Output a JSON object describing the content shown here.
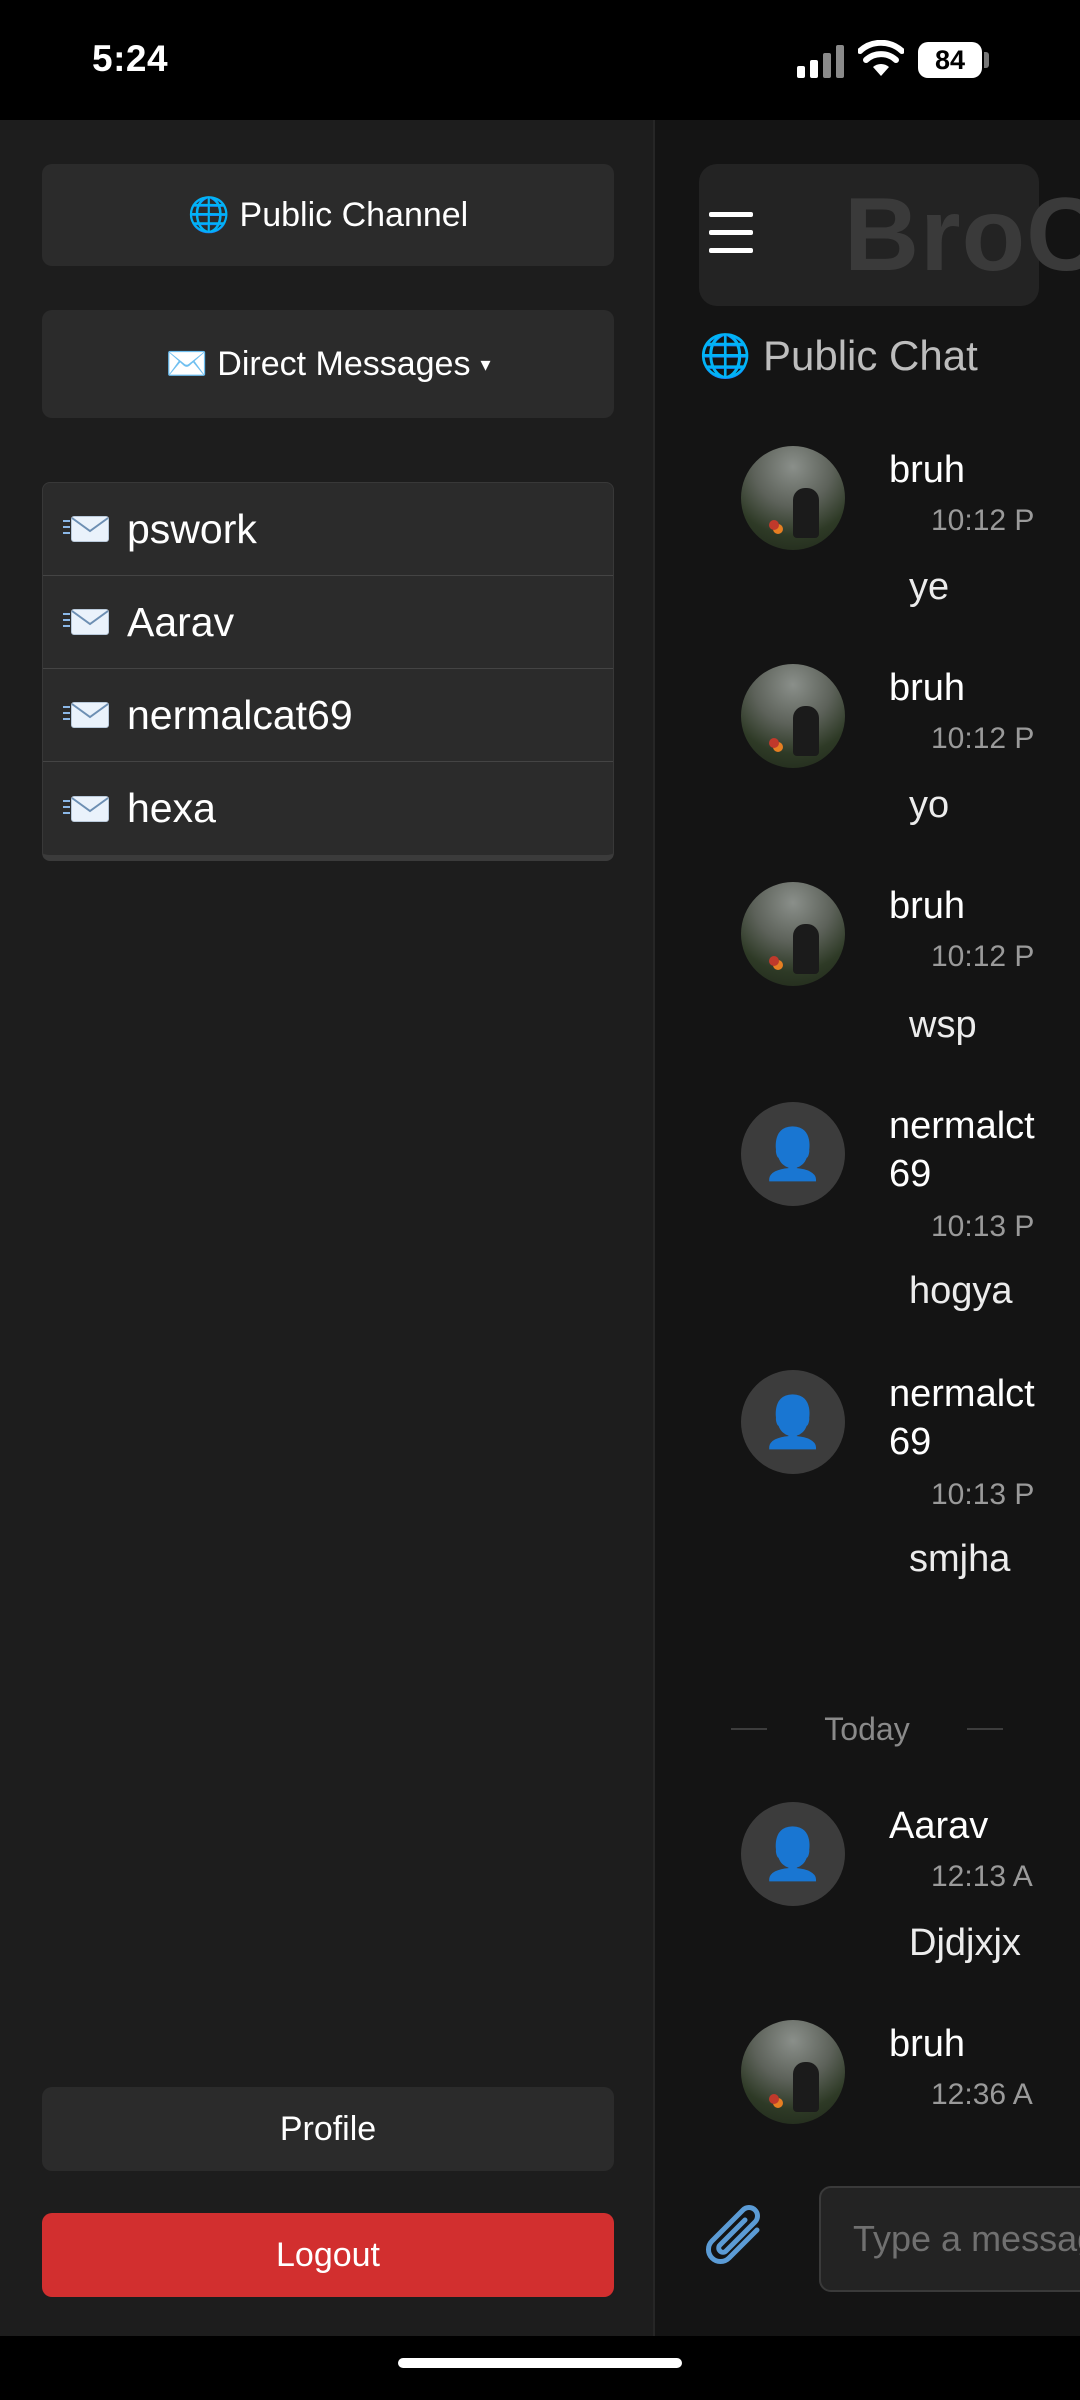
{
  "status_bar": {
    "time": "5:24",
    "battery": "84"
  },
  "sidebar": {
    "public_channel": {
      "icon": "globe-icon",
      "label": "🌐 Public Channel"
    },
    "direct_messages": {
      "icon": "envelope-icon",
      "label": "✉️ Direct Messages",
      "caret": "▾"
    },
    "dm_items": [
      {
        "icon": "incoming-envelope-icon",
        "label": "pswork"
      },
      {
        "icon": "incoming-envelope-icon",
        "label": "Aarav"
      },
      {
        "icon": "incoming-envelope-icon",
        "label": "nermalcat69"
      },
      {
        "icon": "incoming-envelope-icon",
        "label": "hexa"
      }
    ],
    "profile_label": "Profile",
    "logout_label": "Logout",
    "logout_color": "#d22f2f"
  },
  "chat": {
    "menu_icon": "☰",
    "brand": "BroC",
    "channel_title": "🌐 Public Chat",
    "messages": [
      {
        "user": "bruh",
        "time": "10:12 P",
        "text": "ye",
        "avatar": "photo"
      },
      {
        "user": "bruh",
        "time": "10:12 P",
        "text": "yo",
        "avatar": "photo"
      },
      {
        "user": "bruh",
        "time": "10:12 P",
        "text": "wsp",
        "avatar": "photo"
      },
      {
        "user": "nermalct69",
        "time": "10:13 P",
        "text": "hogya",
        "avatar": "default"
      },
      {
        "user": "nermalct69",
        "time": "10:13 P",
        "text": "smjha",
        "avatar": "default"
      },
      {
        "user": "Aarav",
        "time": "12:13 A",
        "text": "Djdjxjx",
        "avatar": "default"
      },
      {
        "user": "bruh",
        "time": "12:36 A",
        "text": "",
        "avatar": "photo"
      }
    ],
    "divider_label": "Today",
    "input_placeholder": "Type a messag",
    "attach_icon": "paperclip-icon"
  }
}
